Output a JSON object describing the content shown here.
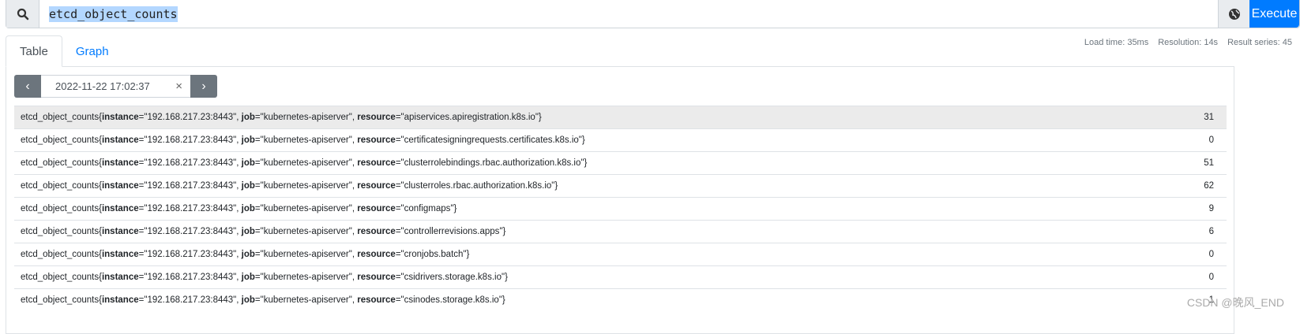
{
  "query": {
    "value": "etcd_object_counts",
    "execute_label": "Execute"
  },
  "tabs": [
    {
      "label": "Table"
    },
    {
      "label": "Graph"
    }
  ],
  "stats": {
    "load_time": "Load time: 35ms",
    "resolution": "Resolution: 14s",
    "result_series": "Result series: 45"
  },
  "time_nav": {
    "value": "2022-11-22 17:02:37",
    "clear": "×",
    "prev": "‹",
    "next": "›"
  },
  "rows": [
    {
      "metric": "etcd_object_counts",
      "instance": "192.168.217.23:8443",
      "job": "kubernetes-apiserver",
      "resource": "apiservices.apiregistration.k8s.io",
      "value": "31"
    },
    {
      "metric": "etcd_object_counts",
      "instance": "192.168.217.23:8443",
      "job": "kubernetes-apiserver",
      "resource": "certificatesigningrequests.certificates.k8s.io",
      "value": "0"
    },
    {
      "metric": "etcd_object_counts",
      "instance": "192.168.217.23:8443",
      "job": "kubernetes-apiserver",
      "resource": "clusterrolebindings.rbac.authorization.k8s.io",
      "value": "51"
    },
    {
      "metric": "etcd_object_counts",
      "instance": "192.168.217.23:8443",
      "job": "kubernetes-apiserver",
      "resource": "clusterroles.rbac.authorization.k8s.io",
      "value": "62"
    },
    {
      "metric": "etcd_object_counts",
      "instance": "192.168.217.23:8443",
      "job": "kubernetes-apiserver",
      "resource": "configmaps",
      "value": "9"
    },
    {
      "metric": "etcd_object_counts",
      "instance": "192.168.217.23:8443",
      "job": "kubernetes-apiserver",
      "resource": "controllerrevisions.apps",
      "value": "6"
    },
    {
      "metric": "etcd_object_counts",
      "instance": "192.168.217.23:8443",
      "job": "kubernetes-apiserver",
      "resource": "cronjobs.batch",
      "value": "0"
    },
    {
      "metric": "etcd_object_counts",
      "instance": "192.168.217.23:8443",
      "job": "kubernetes-apiserver",
      "resource": "csidrivers.storage.k8s.io",
      "value": "0"
    },
    {
      "metric": "etcd_object_counts",
      "instance": "192.168.217.23:8443",
      "job": "kubernetes-apiserver",
      "resource": "csinodes.storage.k8s.io",
      "value": "1"
    }
  ],
  "watermark": "CSDN @晚风_END"
}
